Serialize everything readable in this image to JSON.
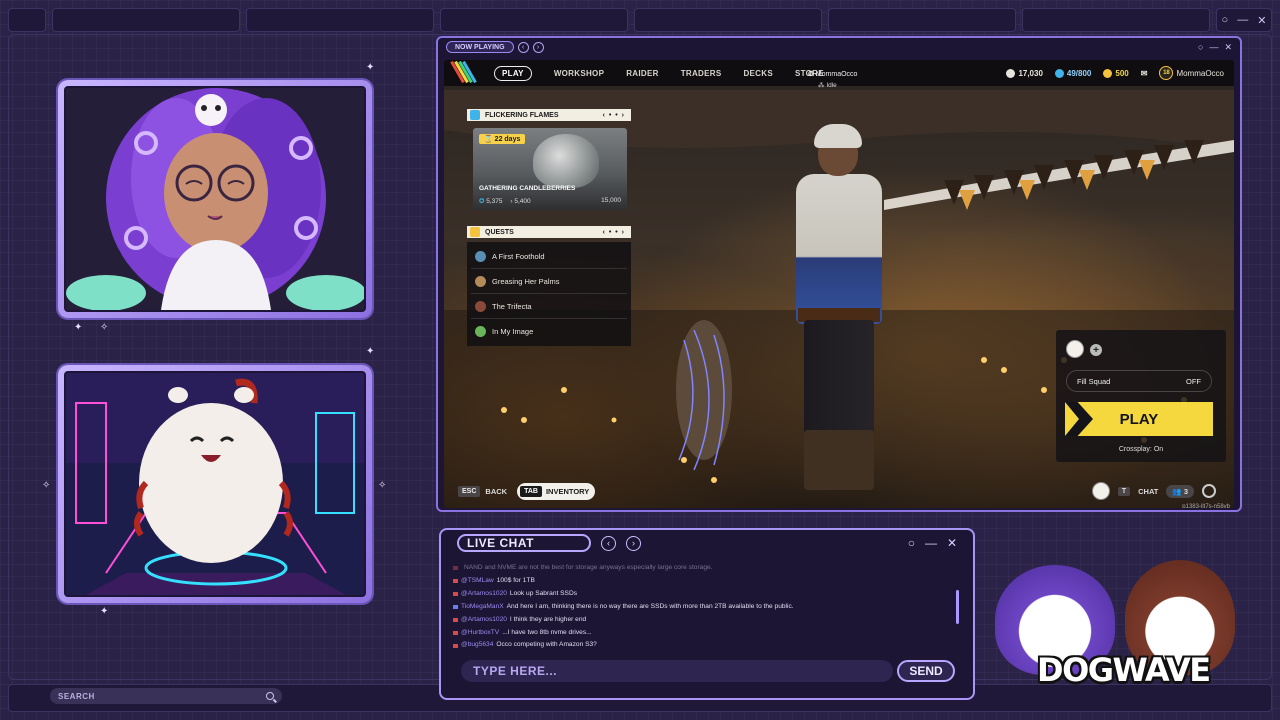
{
  "game": {
    "now_playing": "NOW PLAYING",
    "nav": [
      "PLAY",
      "WORKSHOP",
      "RAIDER",
      "TRADERS",
      "DECKS",
      "STORE"
    ],
    "currency": {
      "coins": "17,030",
      "raider_tokens": "49/800",
      "cred": "500",
      "level": "18",
      "username": "MommaOcco"
    },
    "player_tag": {
      "name": "MommaOcco",
      "status": "Idle"
    },
    "event": {
      "header": "FLICKERING FLAMES",
      "pager": "‹ • • ›",
      "days": "22  days",
      "title": "GATHERING CANDLEBERRIES",
      "progress_current": "5,375",
      "progress_mid": "5,400",
      "progress_max": "15,000"
    },
    "quests": {
      "header": "QUESTS",
      "pager": "‹ • • ›",
      "items": [
        "A First Foothold",
        "Greasing Her Palms",
        "The Trifecta",
        "In My Image"
      ]
    },
    "squad": {
      "fill_label": "Fill Squad",
      "fill_value": "OFF",
      "play_label": "PLAY",
      "crossplay": "Crossplay: On"
    },
    "bottom": {
      "esc_key": "ESC",
      "back_label": "BACK",
      "tab_key": "TAB",
      "inventory_label": "INVENTORY",
      "t_key": "T",
      "chat_label": "CHAT",
      "party_count": "3",
      "session_id": "p1383-llt7s-n58vb"
    }
  },
  "chat": {
    "title": "LIVE CHAT",
    "messages": [
      {
        "user": "",
        "text": "NAND and NVME are not the best for storage anyways especially large core storage.",
        "faded": true
      },
      {
        "user": "@TSMLaw",
        "text": "100$ for 1TB",
        "faded": false
      },
      {
        "user": "@Artamos1020",
        "text": "Look up Sabrant SSDs",
        "faded": false
      },
      {
        "user": "TioMegaManX",
        "text": "And here I am, thinking there is no way there are SSDs with more than 2TB available to the public.",
        "faded": false
      },
      {
        "user": "@Artamos1020",
        "text": "I think they are higher end",
        "faded": false
      },
      {
        "user": "@HurtboxTV",
        "text": "...I have two 8tb nvme drives...",
        "faded": false
      },
      {
        "user": "@bug5634",
        "text": "Occo competing with Amazon S3?",
        "faded": false
      }
    ],
    "input_placeholder": "TYPE HERE...",
    "send_label": "SEND"
  },
  "search": {
    "label": "SEARCH"
  },
  "logo": {
    "text": "DOGWAVE"
  },
  "colors": {
    "accent_purple": "#a995f5",
    "play_yellow": "#f4d83e",
    "background": "#2b2248"
  }
}
